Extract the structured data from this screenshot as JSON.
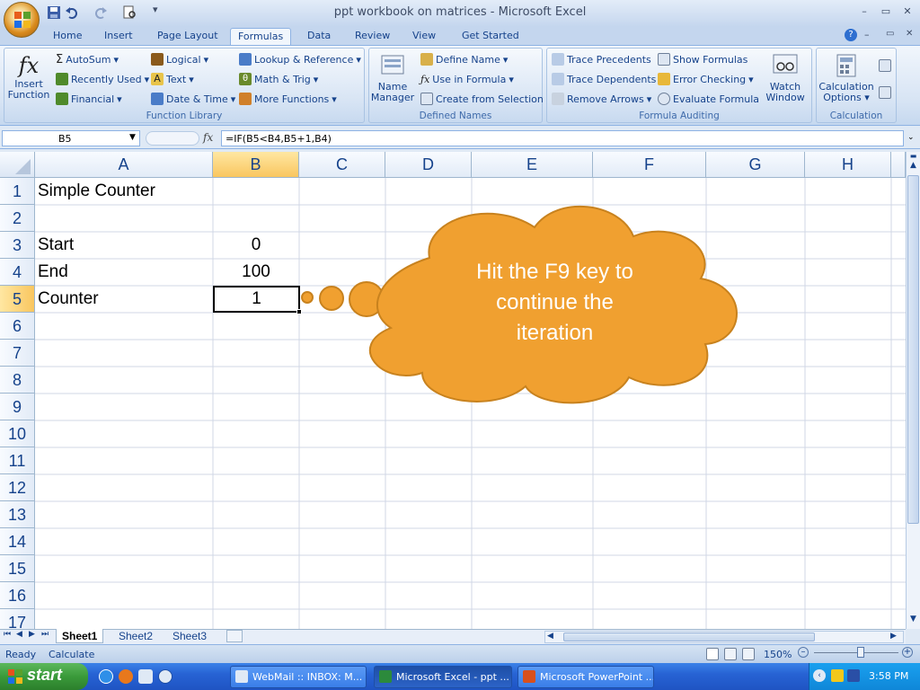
{
  "window": {
    "title": "ppt workbook on matrices - Microsoft Excel",
    "minimize": "–",
    "restore": "▭",
    "close": "✕"
  },
  "tabs": [
    "Home",
    "Insert",
    "Page Layout",
    "Formulas",
    "Data",
    "Review",
    "View",
    "Get Started"
  ],
  "active_tab": "Formulas",
  "ribbon": {
    "function_library": {
      "label": "Function Library",
      "insert_function": "Insert Function",
      "insert_function_line1": "Insert",
      "insert_function_line2": "Function",
      "autosum": "AutoSum",
      "recently_used": "Recently Used",
      "financial": "Financial",
      "logical": "Logical",
      "text": "Text",
      "date_time": "Date & Time",
      "lookup": "Lookup & Reference",
      "math": "Math & Trig",
      "more": "More Functions"
    },
    "defined_names": {
      "label": "Defined Names",
      "name_manager_line1": "Name",
      "name_manager_line2": "Manager",
      "define_name": "Define Name",
      "use_in_formula": "Use in Formula",
      "create_from_selection": "Create from Selection"
    },
    "formula_auditing": {
      "label": "Formula Auditing",
      "trace_precedents": "Trace Precedents",
      "trace_dependents": "Trace Dependents",
      "remove_arrows": "Remove Arrows",
      "show_formulas": "Show Formulas",
      "error_checking": "Error Checking",
      "evaluate_formula": "Evaluate Formula",
      "watch_line1": "Watch",
      "watch_line2": "Window"
    },
    "calculation": {
      "label": "Calculation",
      "options_line1": "Calculation",
      "options_line2": "Options"
    }
  },
  "formula_bar": {
    "name_box": "B5",
    "fx": "fx",
    "formula": "=IF(B5<B4,B5+1,B4)"
  },
  "columns": [
    "A",
    "B",
    "C",
    "D",
    "E",
    "F",
    "G",
    "H"
  ],
  "rows": [
    "1",
    "2",
    "3",
    "4",
    "5",
    "6",
    "7",
    "8",
    "9",
    "10",
    "11",
    "12",
    "13",
    "14",
    "15",
    "16",
    "17"
  ],
  "cells": {
    "A1": "Simple Counter",
    "A3": "Start",
    "B3": "0",
    "A4": "End",
    "B4": "100",
    "A5": "Counter",
    "B5": "1"
  },
  "callout": {
    "line1": "Hit the F9 key to",
    "line2": "continue the",
    "line3": "iteration",
    "color": "#f0a030"
  },
  "sheets": [
    "Sheet1",
    "Sheet2",
    "Sheet3"
  ],
  "active_sheet": "Sheet1",
  "status": {
    "ready": "Ready",
    "calculate": "Calculate",
    "zoom": "150%"
  },
  "taskbar": {
    "start": "start",
    "tasks": [
      "WebMail :: INBOX: M...",
      "Microsoft Excel - ppt ...",
      "Microsoft PowerPoint ..."
    ],
    "clock": "3:58 PM"
  }
}
